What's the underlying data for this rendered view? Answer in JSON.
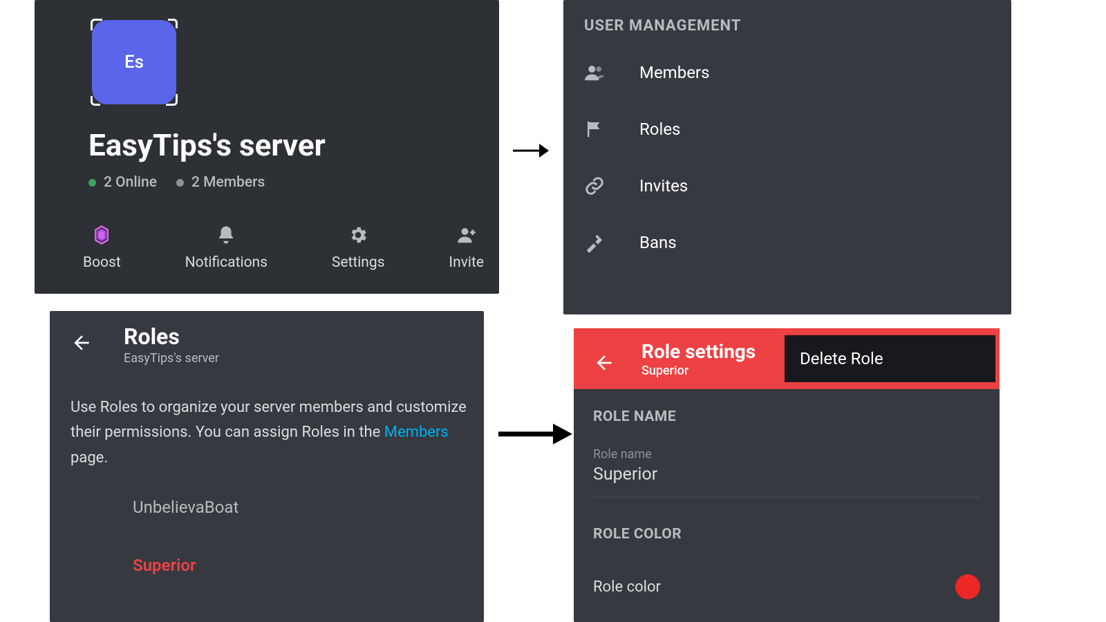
{
  "server_profile": {
    "icon_text": "Es",
    "name": "EasyTips's server",
    "online_count": "2 Online",
    "members_count": "2 Members",
    "actions": {
      "boost": "Boost",
      "notifications": "Notifications",
      "settings": "Settings",
      "invite": "Invite"
    }
  },
  "user_management": {
    "heading": "USER MANAGEMENT",
    "items": {
      "members": "Members",
      "roles": "Roles",
      "invites": "Invites",
      "bans": "Bans"
    }
  },
  "roles_screen": {
    "title": "Roles",
    "subtitle": "EasyTips's server",
    "desc_prefix": "Use Roles to organize your server members and customize their permissions. You can assign Roles in the ",
    "desc_link": "Members",
    "desc_suffix": " page.",
    "role_list": {
      "r0": "UnbelievaBoat",
      "r1": "Superior"
    }
  },
  "role_settings": {
    "title": "Role settings",
    "subtitle": "Superior",
    "delete": "Delete Role",
    "name_section": "ROLE NAME",
    "name_small": "Role name",
    "name_value": "Superior",
    "color_section": "ROLE COLOR",
    "color_label": "Role color",
    "color_hex": "#ed2626"
  }
}
